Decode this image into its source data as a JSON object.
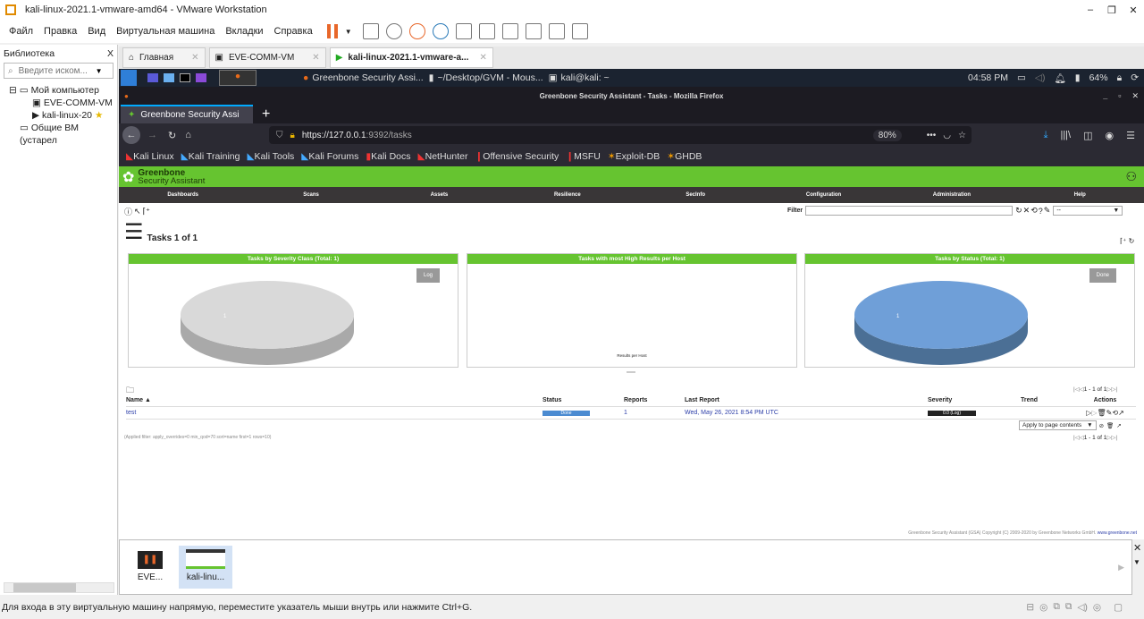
{
  "window": {
    "title": "kali-linux-2021.1-vmware-amd64 - VMware Workstation",
    "controls": [
      "–",
      "❐",
      "✕"
    ]
  },
  "menu": [
    "Файл",
    "Правка",
    "Вид",
    "Виртуальная машина",
    "Вкладки",
    "Справка"
  ],
  "library": {
    "title": "Библиотека",
    "close": "X",
    "search_placeholder": "Введите иском...",
    "tree": [
      {
        "label": "Мой компьютер"
      },
      {
        "label": "EVE-COMM-VM"
      },
      {
        "label": "kali-linux-20"
      },
      {
        "label": "Общие ВМ (устарел"
      }
    ]
  },
  "vm_tabs": [
    {
      "label": "Главная"
    },
    {
      "label": "EVE-COMM-VM"
    },
    {
      "label": "kali-linux-2021.1-vmware-a..."
    }
  ],
  "kali_panel": {
    "windows": [
      "Greenbone Security Assi...",
      "~/Desktop/GVM - Mous...",
      "kali@kali: ~"
    ],
    "time": "04:58 PM",
    "battery": "64%"
  },
  "firefox": {
    "title": "Greenbone Security Assistant - Tasks - Mozilla Firefox",
    "tab": "Greenbone Security Assi",
    "new_tab": "+",
    "url_host": "https://127.0.0.1",
    "url_path": ":9392/tasks",
    "zoom": "80%",
    "bookmarks": [
      "Kali Linux",
      "Kali Training",
      "Kali Tools",
      "Kali Forums",
      "Kali Docs",
      "NetHunter",
      "Offensive Security",
      "MSFU",
      "Exploit-DB",
      "GHDB"
    ]
  },
  "gsa": {
    "brand1": "Greenbone",
    "brand2": "Security Assistant",
    "nav": [
      "Dashboards",
      "Scans",
      "Assets",
      "Resilience",
      "SecInfo",
      "Configuration",
      "Administration",
      "Help"
    ],
    "filter_label": "Filter",
    "filter_select": "--",
    "page_title": "Tasks 1 of 1",
    "charts": [
      {
        "title": "Tasks by Severity Class (Total: 1)",
        "legend": "Log",
        "label": "1",
        "color": "#d9d9d9"
      },
      {
        "title": "Tasks with most High Results per Host",
        "xlabel": "Results per Host"
      },
      {
        "title": "Tasks by Status (Total: 1)",
        "legend": "Done",
        "label": "1",
        "color": "#6f9fd8"
      }
    ],
    "pagination": "1 - 1 of 1",
    "columns": [
      "Name ▲",
      "Status",
      "Reports",
      "Last Report",
      "Severity",
      "Trend",
      "Actions"
    ],
    "rows": [
      {
        "name": "test",
        "status": "Done",
        "reports": "1",
        "last_report": "Wed, May 26, 2021 8:54 PM UTC",
        "severity": "0.0 (Log)"
      }
    ],
    "bulk_select": "Apply to page contents",
    "applied_filter": "(Applied filter: apply_overrides=0 min_qod=70 sort=name first=1 rows=10)",
    "footer": "Greenbone Security Assistant (GSA) Copyright (C) 2009-2020 by Greenbone Networks GmbH.",
    "footer_link": "www.greenbone.net"
  },
  "thumbnails": [
    {
      "label": "EVE..."
    },
    {
      "label": "kali-linu..."
    }
  ],
  "status_text": "Для входа в эту виртуальную машину напрямую, переместите указатель мыши внутрь или нажмите Ctrl+G."
}
